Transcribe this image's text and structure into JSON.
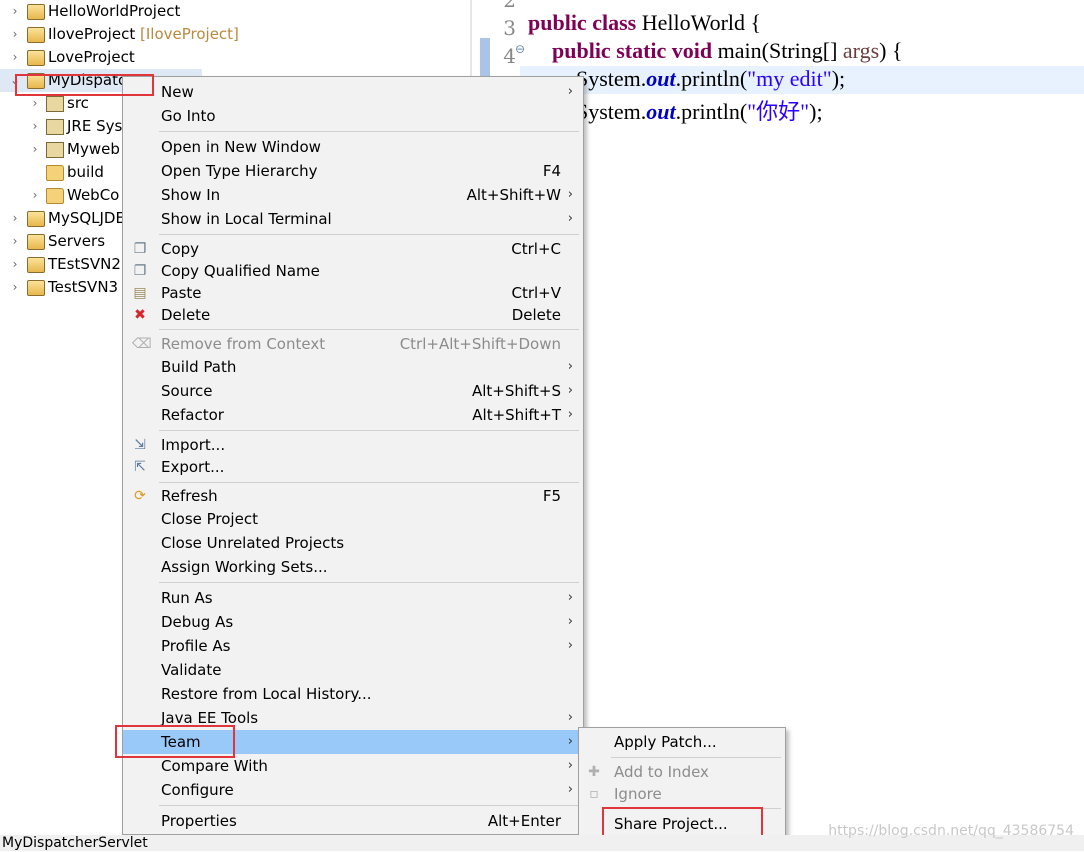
{
  "explorer": {
    "items": [
      {
        "label": "HelloWorldProject",
        "decoration": "",
        "expanded": false
      },
      {
        "label": "IloveProject",
        "decoration": "[IloveProject]",
        "expanded": false
      },
      {
        "label": "LoveProject",
        "decoration": "",
        "expanded": false
      },
      {
        "label": "MyDispatc",
        "decoration": "",
        "expanded": true
      },
      {
        "label": "src",
        "decoration": "",
        "expanded": false
      },
      {
        "label": "JRE Syst",
        "decoration": "",
        "expanded": false
      },
      {
        "label": "Myweb",
        "decoration": "",
        "expanded": false
      },
      {
        "label": "build",
        "decoration": "",
        "expanded": false
      },
      {
        "label": "WebCo",
        "decoration": "",
        "expanded": false
      },
      {
        "label": "MySQLJDE",
        "decoration": "",
        "expanded": false
      },
      {
        "label": "Servers",
        "decoration": "",
        "expanded": false
      },
      {
        "label": "TEstSVN2",
        "decoration": "",
        "expanded": false
      },
      {
        "label": "TestSVN3",
        "decoration": "",
        "expanded": false
      }
    ]
  },
  "editor": {
    "line_numbers": [
      "2",
      "3",
      "4"
    ],
    "fold_marker": "⊖",
    "code": {
      "line3": {
        "kw": "public class",
        "rest": " HelloWorld {"
      },
      "line4": {
        "kw": "public static void",
        "rest": " main(String[] ",
        "param": "args",
        "tail": ") {"
      },
      "line5": {
        "pre": "System.",
        "field": "out",
        "mid": ".println(",
        "str": "\"my edit\"",
        "tail": ");"
      },
      "line6": {
        "pre": "System.",
        "field": "out",
        "mid": ".println(",
        "str": "\"你好\"",
        "tail": ");"
      }
    }
  },
  "context_menu": {
    "items": [
      {
        "label": "New",
        "shortcut": "",
        "submenu": true,
        "icon": "",
        "disabled": false
      },
      {
        "label": "Go Into",
        "shortcut": "",
        "submenu": false,
        "icon": "",
        "disabled": false
      },
      {
        "label": "Open in New Window",
        "shortcut": "",
        "submenu": false,
        "icon": "",
        "disabled": false
      },
      {
        "label": "Open Type Hierarchy",
        "shortcut": "F4",
        "submenu": false,
        "icon": "",
        "disabled": false
      },
      {
        "label": "Show In",
        "shortcut": "Alt+Shift+W",
        "submenu": true,
        "icon": "",
        "disabled": false
      },
      {
        "label": "Show in Local Terminal",
        "shortcut": "",
        "submenu": true,
        "icon": "",
        "disabled": false
      },
      {
        "label": "Copy",
        "shortcut": "Ctrl+C",
        "submenu": false,
        "icon": "copy-icon",
        "disabled": false
      },
      {
        "label": "Copy Qualified Name",
        "shortcut": "",
        "submenu": false,
        "icon": "copy-qualified-icon",
        "disabled": false
      },
      {
        "label": "Paste",
        "shortcut": "Ctrl+V",
        "submenu": false,
        "icon": "paste-icon",
        "disabled": false
      },
      {
        "label": "Delete",
        "shortcut": "Delete",
        "submenu": false,
        "icon": "delete-icon",
        "disabled": false
      },
      {
        "label": "Remove from Context",
        "shortcut": "Ctrl+Alt+Shift+Down",
        "submenu": false,
        "icon": "remove-context-icon",
        "disabled": true
      },
      {
        "label": "Build Path",
        "shortcut": "",
        "submenu": true,
        "icon": "",
        "disabled": false
      },
      {
        "label": "Source",
        "shortcut": "Alt+Shift+S",
        "submenu": true,
        "icon": "",
        "disabled": false
      },
      {
        "label": "Refactor",
        "shortcut": "Alt+Shift+T",
        "submenu": true,
        "icon": "",
        "disabled": false
      },
      {
        "label": "Import...",
        "shortcut": "",
        "submenu": false,
        "icon": "import-icon",
        "disabled": false
      },
      {
        "label": "Export...",
        "shortcut": "",
        "submenu": false,
        "icon": "export-icon",
        "disabled": false
      },
      {
        "label": "Refresh",
        "shortcut": "F5",
        "submenu": false,
        "icon": "refresh-icon",
        "disabled": false
      },
      {
        "label": "Close Project",
        "shortcut": "",
        "submenu": false,
        "icon": "",
        "disabled": false
      },
      {
        "label": "Close Unrelated Projects",
        "shortcut": "",
        "submenu": false,
        "icon": "",
        "disabled": false
      },
      {
        "label": "Assign Working Sets...",
        "shortcut": "",
        "submenu": false,
        "icon": "",
        "disabled": false
      },
      {
        "label": "Run As",
        "shortcut": "",
        "submenu": true,
        "icon": "",
        "disabled": false
      },
      {
        "label": "Debug As",
        "shortcut": "",
        "submenu": true,
        "icon": "",
        "disabled": false
      },
      {
        "label": "Profile As",
        "shortcut": "",
        "submenu": true,
        "icon": "",
        "disabled": false
      },
      {
        "label": "Validate",
        "shortcut": "",
        "submenu": false,
        "icon": "",
        "disabled": false
      },
      {
        "label": "Restore from Local History...",
        "shortcut": "",
        "submenu": false,
        "icon": "",
        "disabled": false
      },
      {
        "label": "Java EE Tools",
        "shortcut": "",
        "submenu": true,
        "icon": "",
        "disabled": false
      },
      {
        "label": "Team",
        "shortcut": "",
        "submenu": true,
        "icon": "",
        "disabled": false,
        "highlighted": true
      },
      {
        "label": "Compare With",
        "shortcut": "",
        "submenu": true,
        "icon": "",
        "disabled": false
      },
      {
        "label": "Configure",
        "shortcut": "",
        "submenu": true,
        "icon": "",
        "disabled": false
      },
      {
        "label": "Properties",
        "shortcut": "Alt+Enter",
        "submenu": false,
        "icon": "",
        "disabled": false
      }
    ]
  },
  "team_submenu": {
    "items": [
      {
        "label": "Apply Patch...",
        "icon": "",
        "disabled": false
      },
      {
        "label": "Add to Index",
        "icon": "add-index-icon",
        "disabled": true
      },
      {
        "label": "Ignore",
        "icon": "ignore-icon",
        "disabled": true
      },
      {
        "label": "Share Project...",
        "icon": "",
        "disabled": false
      }
    ]
  },
  "status_bar": {
    "text": "MyDispatcherServlet"
  },
  "watermark": "https://blog.csdn.net/qq_43586754",
  "colors": {
    "highlight": "#99c9f8",
    "annotation_red": "#e0353a",
    "keyword": "#7f0055",
    "string": "#2a00ff",
    "field": "#0000c0"
  }
}
